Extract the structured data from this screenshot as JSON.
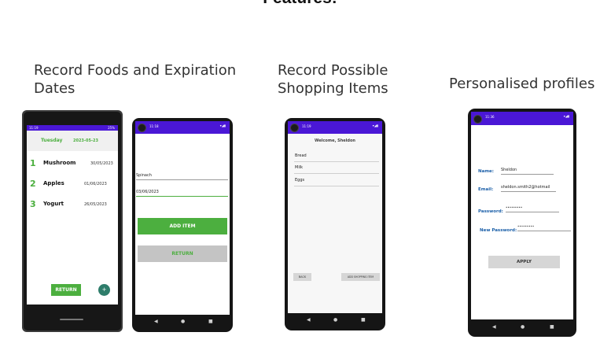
{
  "page": {
    "title": "Features:"
  },
  "captions": {
    "foods": "Record Foods and Expiration Dates",
    "foods_line1": "Record Foods and Expiration",
    "foods_line2": "Dates",
    "shopping_line1": "Record Possible",
    "shopping_line2": "Shopping Items",
    "profiles": "Personalised profiles"
  },
  "phone1": {
    "status_time": "11:19",
    "status_right": "25%",
    "header_day": "Tuesday",
    "header_date": "2023-05-23",
    "items": [
      {
        "num": "1",
        "name": "Mushroom",
        "date": "30/05/2023"
      },
      {
        "num": "2",
        "name": "Apples",
        "date": "01/06/2023"
      },
      {
        "num": "3",
        "name": "Yogurt",
        "date": "26/05/2023"
      }
    ],
    "return_label": "RETURN",
    "fab_label": "+"
  },
  "phone2": {
    "status_time": "11:18",
    "food_value": "Spinach",
    "date_value": "03/06/2023",
    "add_label": "ADD ITEM",
    "return_label": "RETURN"
  },
  "phone3": {
    "status_time": "11:19",
    "welcome": "Welcome, Sheldon",
    "items": [
      "Bread",
      "Milk",
      "Eggs"
    ],
    "back_label": "BACK",
    "add_label": "ADD SHOPPING ITEM"
  },
  "phone4": {
    "status_time": "11:36",
    "name_label": "Name:",
    "name_value": "Sheldon",
    "email_label": "Email:",
    "email_value": "sheldon.smith2@hotmail",
    "password_label": "Password:",
    "password_value": "•••••••••",
    "new_password_label": "New Password:",
    "new_password_value": "•••••••••",
    "apply_label": "APPLY"
  },
  "colors": {
    "status_bar": "#4a17d6",
    "green": "#4caf3f",
    "teal_fab": "#2e7d6b",
    "label_blue": "#1b5fa8"
  },
  "nav_icons": [
    "back-triangle-icon",
    "home-circle-icon",
    "recents-square-icon"
  ]
}
